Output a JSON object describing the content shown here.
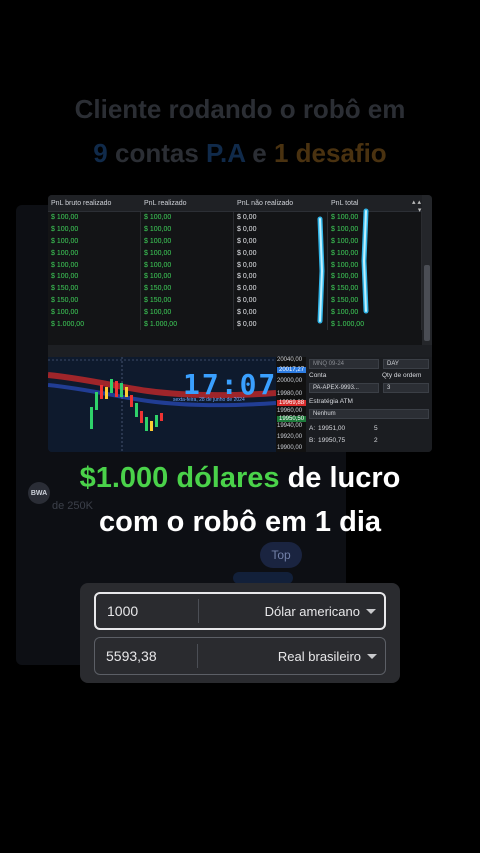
{
  "headline": {
    "line1": "Cliente rodando o robô em",
    "line2_num1": "9",
    "line2_mid": " contas ",
    "line2_pa": "P.A",
    "line2_e": " e ",
    "line2_num2": "1",
    "line2_end": " desafio"
  },
  "pnl_table": {
    "headers": [
      "PnL bruto realizado",
      "PnL realizado",
      "PnL não realizado",
      "PnL total"
    ],
    "rows": [
      [
        "$ 100,00",
        "$ 100,00",
        "$ 0,00",
        "$ 100,00"
      ],
      [
        "$ 100,00",
        "$ 100,00",
        "$ 0,00",
        "$ 100,00"
      ],
      [
        "$ 100,00",
        "$ 100,00",
        "$ 0,00",
        "$ 100,00"
      ],
      [
        "$ 100,00",
        "$ 100,00",
        "$ 0,00",
        "$ 100,00"
      ],
      [
        "$ 100,00",
        "$ 100,00",
        "$ 0,00",
        "$ 100,00"
      ],
      [
        "$ 100,00",
        "$ 100,00",
        "$ 0,00",
        "$ 100,00"
      ],
      [
        "$ 150,00",
        "$ 150,00",
        "$ 0,00",
        "$ 150,00"
      ],
      [
        "$ 150,00",
        "$ 150,00",
        "$ 0,00",
        "$ 150,00"
      ],
      [
        "$ 100,00",
        "$ 100,00",
        "$ 0,00",
        "$ 100,00"
      ],
      [
        "$ 1.000,00",
        "$ 1.000,00",
        "$ 0,00",
        "$ 1.000,00"
      ]
    ]
  },
  "chart": {
    "clock": "17:07",
    "date": "sexta-feira, 28 de junho de 2024",
    "prices": [
      "20040,00",
      "20017,27",
      "20000,00",
      "19980,00",
      "19969,88",
      "19960,00",
      "19950,50",
      "19940,00",
      "19920,00",
      "19900,00"
    ]
  },
  "order_panel": {
    "instrument": "MNQ 09-24",
    "tif": "DAY",
    "conta_label": "Conta",
    "qty_label": "Qty de ordem",
    "account": "PA-APEX-9993...",
    "qty": "3",
    "atm_label": "Estratégia ATM",
    "atm_value": "Nenhum",
    "ask_label": "A:",
    "ask_price": "19951,00",
    "ask_size": "5",
    "bid_label": "B:",
    "bid_price": "19950,75",
    "bid_size": "2"
  },
  "main_text": {
    "amount": "$1.000 dólares",
    "line1_rest": " de lucro",
    "line2": "com o robô em 1 dia"
  },
  "background": {
    "avatar": "BWA",
    "faded_text": "de 250K",
    "top_button": "Top"
  },
  "converter": {
    "from_value": "1000",
    "from_currency": "Dólar americano",
    "to_value": "5593,38",
    "to_currency": "Real brasileiro"
  },
  "colors": {
    "green": "#4ad24a",
    "blue_glow": "#34c6ff",
    "clock_blue": "#3aa0ff"
  }
}
